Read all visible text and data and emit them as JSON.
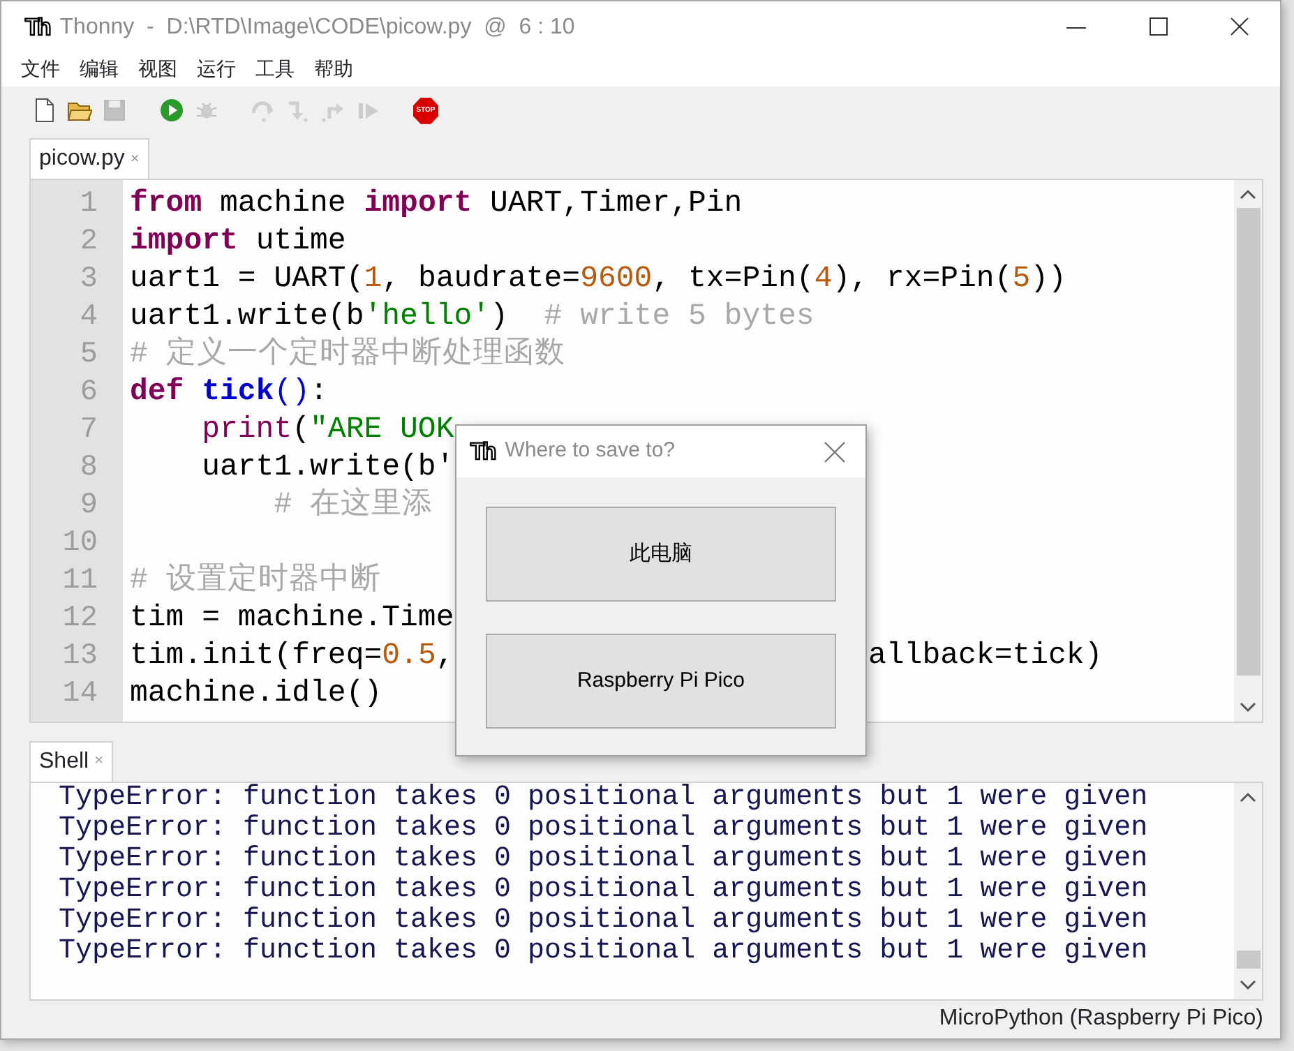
{
  "window": {
    "logo": "Th",
    "title": "Thonny  -  D:\\RTD\\Image\\CODE\\picow.py  @  6 : 10"
  },
  "menu": [
    "文件",
    "编辑",
    "视图",
    "运行",
    "工具",
    "帮助"
  ],
  "toolbar": [
    {
      "kind": "new",
      "disabled": false
    },
    {
      "kind": "open",
      "disabled": false
    },
    {
      "kind": "save",
      "disabled": true
    },
    {
      "kind": "run",
      "disabled": false
    },
    {
      "kind": "debug",
      "disabled": true
    },
    {
      "kind": "step_over",
      "disabled": true
    },
    {
      "kind": "step_into",
      "disabled": true
    },
    {
      "kind": "step_out",
      "disabled": true
    },
    {
      "kind": "resume",
      "disabled": true
    },
    {
      "kind": "stop",
      "disabled": false,
      "label": "STOP"
    }
  ],
  "editor_tabs": [
    {
      "label": "picow.py",
      "close": "×",
      "selected": true
    }
  ],
  "editor": {
    "lines": [
      {
        "number": "1",
        "tokens": [
          {
            "kind": "keyword",
            "text": "from"
          },
          {
            "kind": "plain",
            "text": " machine "
          },
          {
            "kind": "keyword",
            "text": "import"
          },
          {
            "kind": "plain",
            "text": " UART,Timer,Pin"
          }
        ]
      },
      {
        "number": "2",
        "tokens": [
          {
            "kind": "keyword",
            "text": "import"
          },
          {
            "kind": "plain",
            "text": " utime"
          }
        ]
      },
      {
        "number": "3",
        "tokens": [
          {
            "kind": "plain",
            "text": "uart1 = UART("
          },
          {
            "kind": "number",
            "text": "1"
          },
          {
            "kind": "plain",
            "text": ", baudrate="
          },
          {
            "kind": "number",
            "text": "9600"
          },
          {
            "kind": "plain",
            "text": ", tx=Pin("
          },
          {
            "kind": "number",
            "text": "4"
          },
          {
            "kind": "plain",
            "text": "), rx=Pin("
          },
          {
            "kind": "number",
            "text": "5"
          },
          {
            "kind": "plain",
            "text": "))"
          }
        ]
      },
      {
        "number": "4",
        "tokens": [
          {
            "kind": "plain",
            "text": "uart1.write(b"
          },
          {
            "kind": "string",
            "text": "'hello'"
          },
          {
            "kind": "plain",
            "text": ")  "
          },
          {
            "kind": "comment",
            "text": "# write 5 bytes"
          }
        ]
      },
      {
        "number": "5",
        "tokens": [
          {
            "kind": "comment",
            "text": "# 定义一个定时器中断处理函数"
          }
        ]
      },
      {
        "number": "6",
        "tokens": [
          {
            "kind": "keyword",
            "text": "def "
          },
          {
            "kind": "function",
            "text": "tick"
          },
          {
            "kind": "paren",
            "text": "()"
          },
          {
            "kind": "plain",
            "text": ":"
          }
        ],
        "children": [
          {
            "number": "7",
            "tokens": [
              {
                "kind": "builtin",
                "text": "print"
              },
              {
                "kind": "plain",
                "text": "("
              },
              {
                "kind": "string",
                "text": "\"ARE UOK"
              }
            ]
          },
          {
            "number": "8",
            "tokens": [
              {
                "kind": "plain",
                "text": "uart1.write(b'"
              }
            ],
            "children": [
              {
                "number": "9",
                "tokens": [
                  {
                    "kind": "comment",
                    "text": "# 在这里添"
                  }
                ]
              }
            ]
          }
        ]
      },
      {
        "number": "10"
      },
      {
        "number": "11",
        "tokens": [
          {
            "kind": "comment",
            "text": "# 设置定时器中断"
          }
        ]
      },
      {
        "number": "12",
        "tokens": [
          {
            "kind": "plain",
            "text": "tim = machine.Time"
          }
        ]
      },
      {
        "number": "13",
        "tokens": [
          {
            "kind": "plain",
            "text": "tim.init(freq="
          },
          {
            "kind": "number",
            "text": "0.5"
          },
          {
            "kind": "plain",
            "text": ","
          }
        ],
        "tail": "allback=tick)"
      },
      {
        "number": "14",
        "tokens": [
          {
            "kind": "plain",
            "text": "machine.idle()"
          }
        ]
      }
    ]
  },
  "shell_tabs": [
    {
      "label": "Shell",
      "close": "×",
      "selected": true
    }
  ],
  "shell": {
    "lines": [
      "TypeError: function takes 0 positional arguments but 1 were given",
      "TypeError: function takes 0 positional arguments but 1 were given",
      "TypeError: function takes 0 positional arguments but 1 were given",
      "TypeError: function takes 0 positional arguments but 1 were given",
      "TypeError: function takes 0 positional arguments but 1 were given",
      "TypeError: function takes 0 positional arguments but 1 were given"
    ]
  },
  "status_bar": "MicroPython (Raspberry Pi Pico)",
  "dialog": {
    "logo": "Th",
    "title": "Where to save to?",
    "buttons": [
      "此电脑",
      "Raspberry Pi Pico"
    ]
  }
}
